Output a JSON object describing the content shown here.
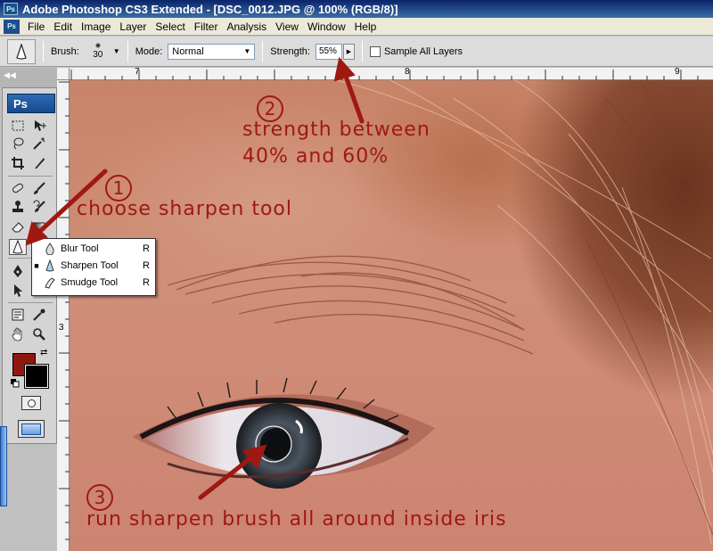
{
  "window": {
    "title": "Adobe Photoshop CS3 Extended - [DSC_0012.JPG @ 100% (RGB/8)]",
    "app_badge": "Ps"
  },
  "menu": [
    "File",
    "Edit",
    "Image",
    "Layer",
    "Select",
    "Filter",
    "Analysis",
    "View",
    "Window",
    "Help"
  ],
  "options": {
    "brush_label": "Brush:",
    "brush_size": "30",
    "mode_label": "Mode:",
    "mode_value": "Normal",
    "strength_label": "Strength:",
    "strength_value": "55%",
    "sample_all_layers": "Sample All Layers",
    "sample_all_layers_checked": false
  },
  "toolbox": {
    "logo": "Ps",
    "foreground_color": "#8f1710",
    "background_color": "#000000"
  },
  "rulers": {
    "horizontal": [
      "7",
      "8",
      "9"
    ],
    "vertical": [
      "3"
    ]
  },
  "flyout": [
    {
      "label": "Blur Tool",
      "key": "R",
      "selected": false,
      "icon": "blur-drop-icon"
    },
    {
      "label": "Sharpen Tool",
      "key": "R",
      "selected": true,
      "icon": "sharpen-cone-icon"
    },
    {
      "label": "Smudge Tool",
      "key": "R",
      "selected": false,
      "icon": "smudge-finger-icon"
    }
  ],
  "annotations": {
    "step1_number": "1",
    "step1_text": "choose sharpen tool",
    "step2_number": "2",
    "step2_line1": "strength between",
    "step2_line2": "40% and 60%",
    "step3_number": "3",
    "step3_text": "run sharpen brush all around inside iris",
    "color": "#a01812"
  }
}
